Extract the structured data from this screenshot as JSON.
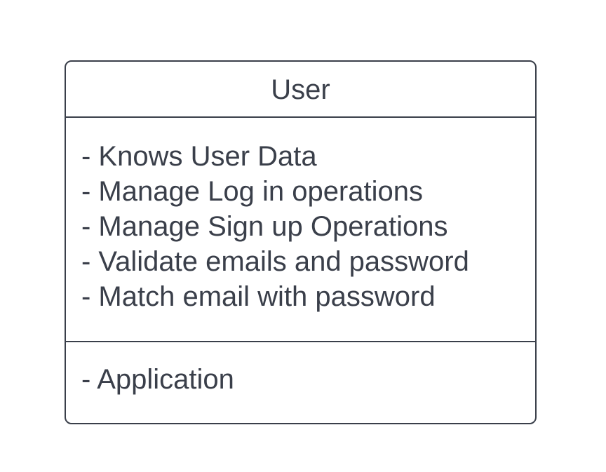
{
  "card": {
    "class_name": "User",
    "responsibilities": [
      "- Knows User Data",
      "- Manage Log in operations",
      "- Manage Sign up Operations",
      "- Validate emails and password",
      "- Match email with password"
    ],
    "collaborators": [
      "- Application"
    ]
  },
  "colors": {
    "stroke": "#3a3f4a",
    "text": "#3a3f4a",
    "background": "#ffffff"
  }
}
